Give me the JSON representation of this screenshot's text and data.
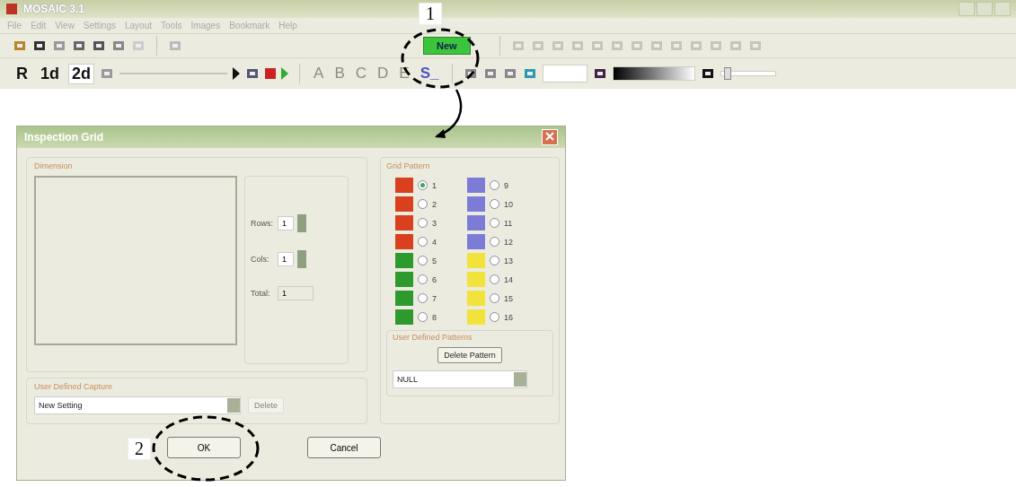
{
  "window": {
    "title": "MOSAIC 3.1"
  },
  "menu": [
    "File",
    "Edit",
    "View",
    "Settings",
    "Layout",
    "Tools",
    "Images",
    "Bookmark",
    "Help"
  ],
  "toolbar": {
    "new_button": "New"
  },
  "toolbar2": {
    "mode_buttons": [
      {
        "label": "R",
        "selected": false
      },
      {
        "label": "1d",
        "selected": false
      },
      {
        "label": "2d",
        "selected": true
      }
    ],
    "letter_buttons": [
      {
        "label": "A",
        "disabled": true
      },
      {
        "label": "B",
        "disabled": true
      },
      {
        "label": "C",
        "disabled": true
      },
      {
        "label": "D",
        "disabled": true
      },
      {
        "label": "E",
        "disabled": true
      },
      {
        "label": "S_",
        "disabled": false
      }
    ],
    "contrast_slider": {
      "level": 0.05
    }
  },
  "dialog": {
    "title": "Inspection Grid",
    "dimension": {
      "label": "Dimension",
      "rows_label": "Rows:",
      "rows_value": "1",
      "cols_label": "Cols:",
      "cols_value": "1",
      "total_label": "Total:",
      "total_value": "1"
    },
    "grid_pattern": {
      "label": "Grid Pattern",
      "options": [
        {
          "label": "1",
          "selected": true,
          "color": "#d8401e"
        },
        {
          "label": "2",
          "selected": false,
          "color": "#d8401e"
        },
        {
          "label": "3",
          "selected": false,
          "color": "#d8401e"
        },
        {
          "label": "4",
          "selected": false,
          "color": "#d8401e"
        },
        {
          "label": "5",
          "selected": false,
          "color": "#2e9a2e"
        },
        {
          "label": "6",
          "selected": false,
          "color": "#2e9a2e"
        },
        {
          "label": "7",
          "selected": false,
          "color": "#2e9a2e"
        },
        {
          "label": "8",
          "selected": false,
          "color": "#2e9a2e"
        },
        {
          "label": "9",
          "selected": false,
          "color": "#7c7cd6"
        },
        {
          "label": "10",
          "selected": false,
          "color": "#7c7cd6"
        },
        {
          "label": "11",
          "selected": false,
          "color": "#7c7cd6"
        },
        {
          "label": "12",
          "selected": false,
          "color": "#7c7cd6"
        },
        {
          "label": "13",
          "selected": false,
          "color": "#f2e23c"
        },
        {
          "label": "14",
          "selected": false,
          "color": "#f2e23c"
        },
        {
          "label": "15",
          "selected": false,
          "color": "#f2e23c"
        },
        {
          "label": "16",
          "selected": false,
          "color": "#f2e23c"
        }
      ]
    },
    "user_patterns": {
      "label": "User Defined Patterns",
      "delete_button": "Delete Pattern",
      "dropdown_value": "NULL"
    },
    "capture": {
      "label": "User Defined Capture",
      "dropdown_value": "New Setting",
      "delete_button": {
        "label": "Delete",
        "disabled": true
      }
    },
    "buttons": [
      "OK",
      "Cancel"
    ]
  },
  "annotations": [
    {
      "label": "1"
    },
    {
      "label": "2"
    }
  ]
}
